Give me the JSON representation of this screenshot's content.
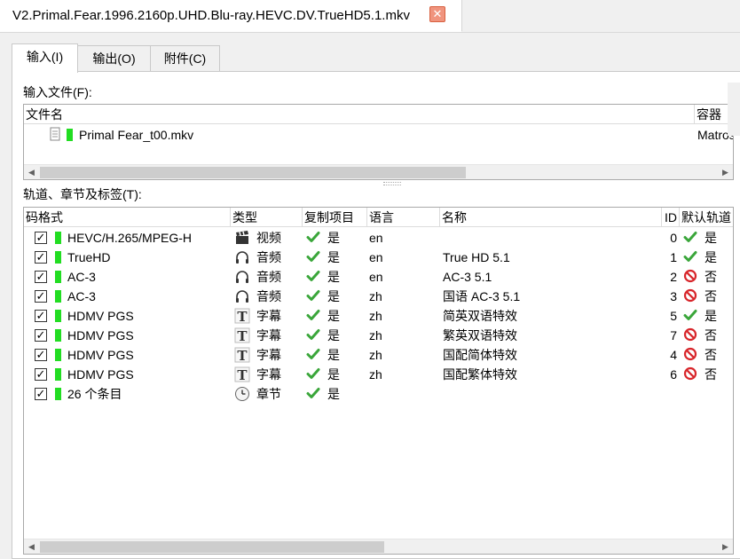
{
  "window": {
    "doc_tab_title": "V2.Primal.Fear.1996.2160p.UHD.Blu-ray.HEVC.DV.TrueHD5.1.mkv",
    "close_glyph": "✕"
  },
  "tabs": [
    {
      "label": "输入(I)"
    },
    {
      "label": "输出(O)"
    },
    {
      "label": "附件(C)"
    }
  ],
  "input_files": {
    "label": "输入文件(F):",
    "headers": {
      "filename": "文件名",
      "container": "容器"
    },
    "rows": [
      {
        "filename": "Primal Fear_t00.mkv",
        "container": "Matroska"
      }
    ]
  },
  "tracks": {
    "label": "轨道、章节及标签(T):",
    "headers": {
      "codec": "码格式",
      "type": "类型",
      "copy": "复制项目",
      "language": "语言",
      "name": "名称",
      "id": "ID",
      "default": "默认轨道"
    },
    "rows": [
      {
        "codec": "HEVC/H.265/MPEG-H",
        "type_icon": "film-clapper-icon",
        "type": "视频",
        "copy": "是",
        "language": "en",
        "name": "",
        "id": "0",
        "default_icon": "check",
        "default": "是"
      },
      {
        "codec": "TrueHD",
        "type_icon": "headphones-icon",
        "type": "音频",
        "copy": "是",
        "language": "en",
        "name": "True HD 5.1",
        "id": "1",
        "default_icon": "check",
        "default": "是"
      },
      {
        "codec": "AC-3",
        "type_icon": "headphones-icon",
        "type": "音频",
        "copy": "是",
        "language": "en",
        "name": "AC-3 5.1",
        "id": "2",
        "default_icon": "no",
        "default": "否"
      },
      {
        "codec": "AC-3",
        "type_icon": "headphones-icon",
        "type": "音频",
        "copy": "是",
        "language": "zh",
        "name": "国语 AC-3 5.1",
        "id": "3",
        "default_icon": "no",
        "default": "否"
      },
      {
        "codec": "HDMV PGS",
        "type_icon": "text-t-icon",
        "type": "字幕",
        "copy": "是",
        "language": "zh",
        "name": "简英双语特效",
        "id": "5",
        "default_icon": "check",
        "default": "是"
      },
      {
        "codec": "HDMV PGS",
        "type_icon": "text-t-icon",
        "type": "字幕",
        "copy": "是",
        "language": "zh",
        "name": "繁英双语特效",
        "id": "7",
        "default_icon": "no",
        "default": "否"
      },
      {
        "codec": "HDMV PGS",
        "type_icon": "text-t-icon",
        "type": "字幕",
        "copy": "是",
        "language": "zh",
        "name": "国配简体特效",
        "id": "4",
        "default_icon": "no",
        "default": "否"
      },
      {
        "codec": "HDMV PGS",
        "type_icon": "text-t-icon",
        "type": "字幕",
        "copy": "是",
        "language": "zh",
        "name": "国配繁体特效",
        "id": "6",
        "default_icon": "no",
        "default": "否"
      },
      {
        "codec": "26 个条目",
        "type_icon": "clock-icon",
        "type": "章节",
        "copy": "是",
        "language": "",
        "name": "",
        "id": "",
        "default_icon": "",
        "default": ""
      }
    ]
  },
  "colors": {
    "track_indicator": "#22dd22",
    "check": "#3aa63a",
    "no": "#d8262b",
    "close_button": "#f0947e"
  }
}
